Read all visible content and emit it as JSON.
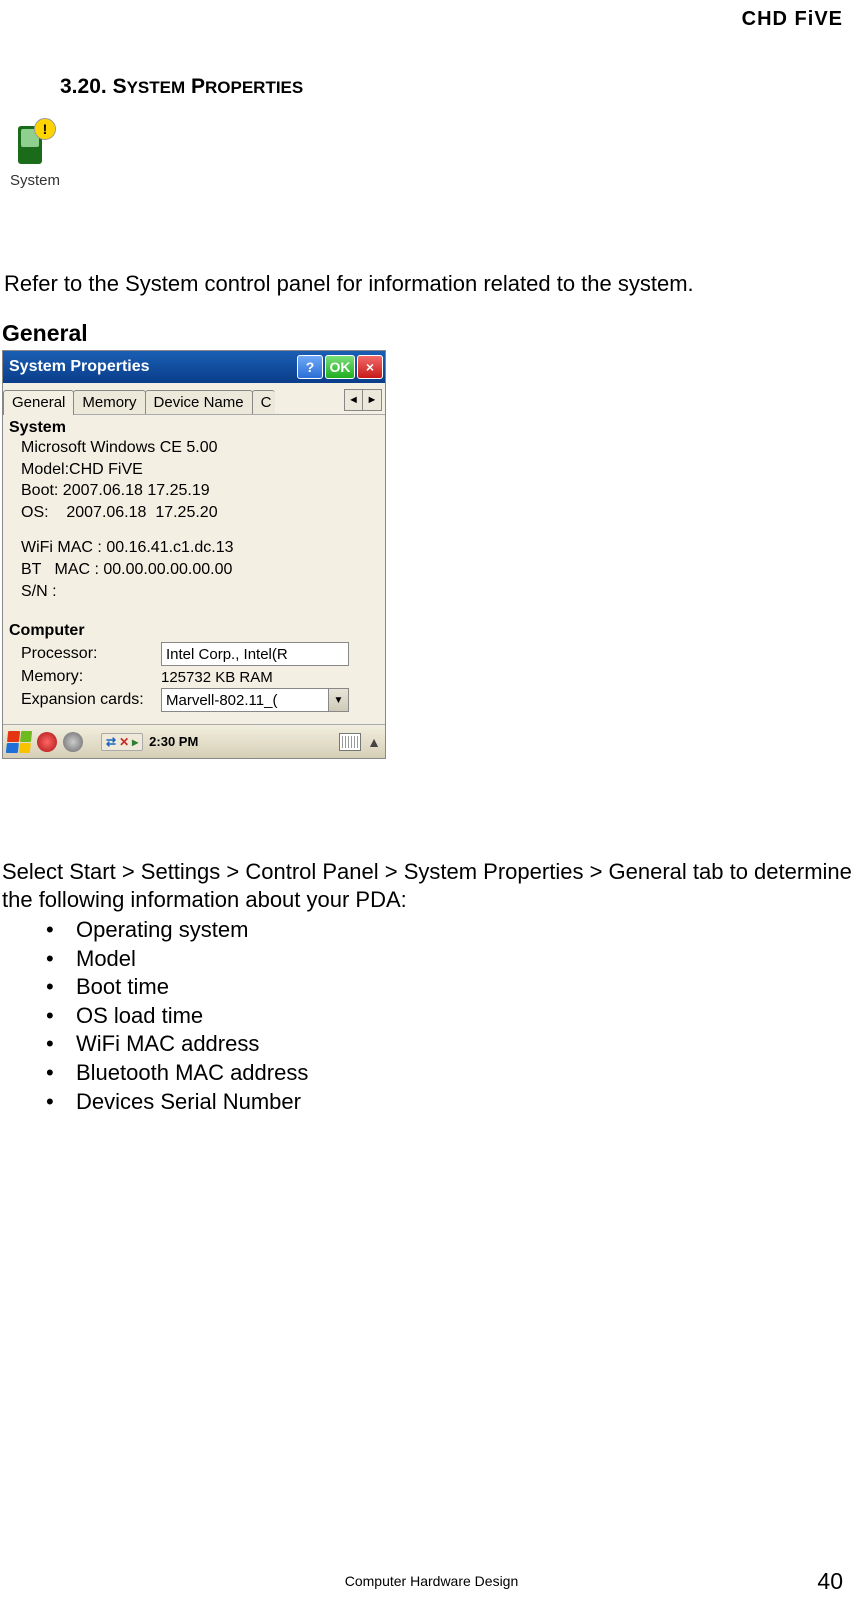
{
  "brand": "CHD FiVE",
  "section": {
    "number": "3.20.",
    "title_part1": "S",
    "title_rest1": "YSTEM",
    "title_part2": "P",
    "title_rest2": "ROPERTIES"
  },
  "system_icon_label": "System",
  "intro": "Refer to the System control panel for information related to the system.",
  "general_heading": "General",
  "screenshot": {
    "title": "System Properties",
    "help": "?",
    "ok": "OK",
    "close": "×",
    "tabs": {
      "general": "General",
      "memory": "Memory",
      "device_name": "Device Name",
      "partial": "C",
      "left_arrow": "◄",
      "right_arrow": "►"
    },
    "system_group": "System",
    "lines": {
      "os": "Microsoft Windows CE 5.00",
      "model": "Model:CHD FiVE",
      "boot": "Boot: 2007.06.18  17.25.19",
      "osline": "OS:    2007.06.18  17.25.20",
      "wifi": "WiFi MAC : 00.16.41.c1.dc.13",
      "bt": "BT   MAC : 00.00.00.00.00.00",
      "sn": "S/N :"
    },
    "computer_group": "Computer",
    "processor_label": "Processor:",
    "processor_value": "Intel Corp., Intel(R",
    "memory_label": "Memory:",
    "memory_value": "125732 KB  RAM",
    "expansion_label": "Expansion cards:",
    "expansion_value": "Marvell-802.11_(",
    "expansion_arrow": "▼",
    "taskbar": {
      "net_icons": "⇄",
      "x_mark": "✕",
      "a_mark": "▸",
      "time": "2:30 PM"
    }
  },
  "body_para": "Select Start > Settings > Control Panel > System Properties > General tab to determine the following information about your PDA:",
  "bullets": [
    "Operating system",
    "Model",
    "Boot time",
    "OS load time",
    "WiFi MAC address",
    "Bluetooth MAC address",
    "Devices Serial Number"
  ],
  "footer_center": "Computer Hardware Design",
  "footer_page": "40"
}
